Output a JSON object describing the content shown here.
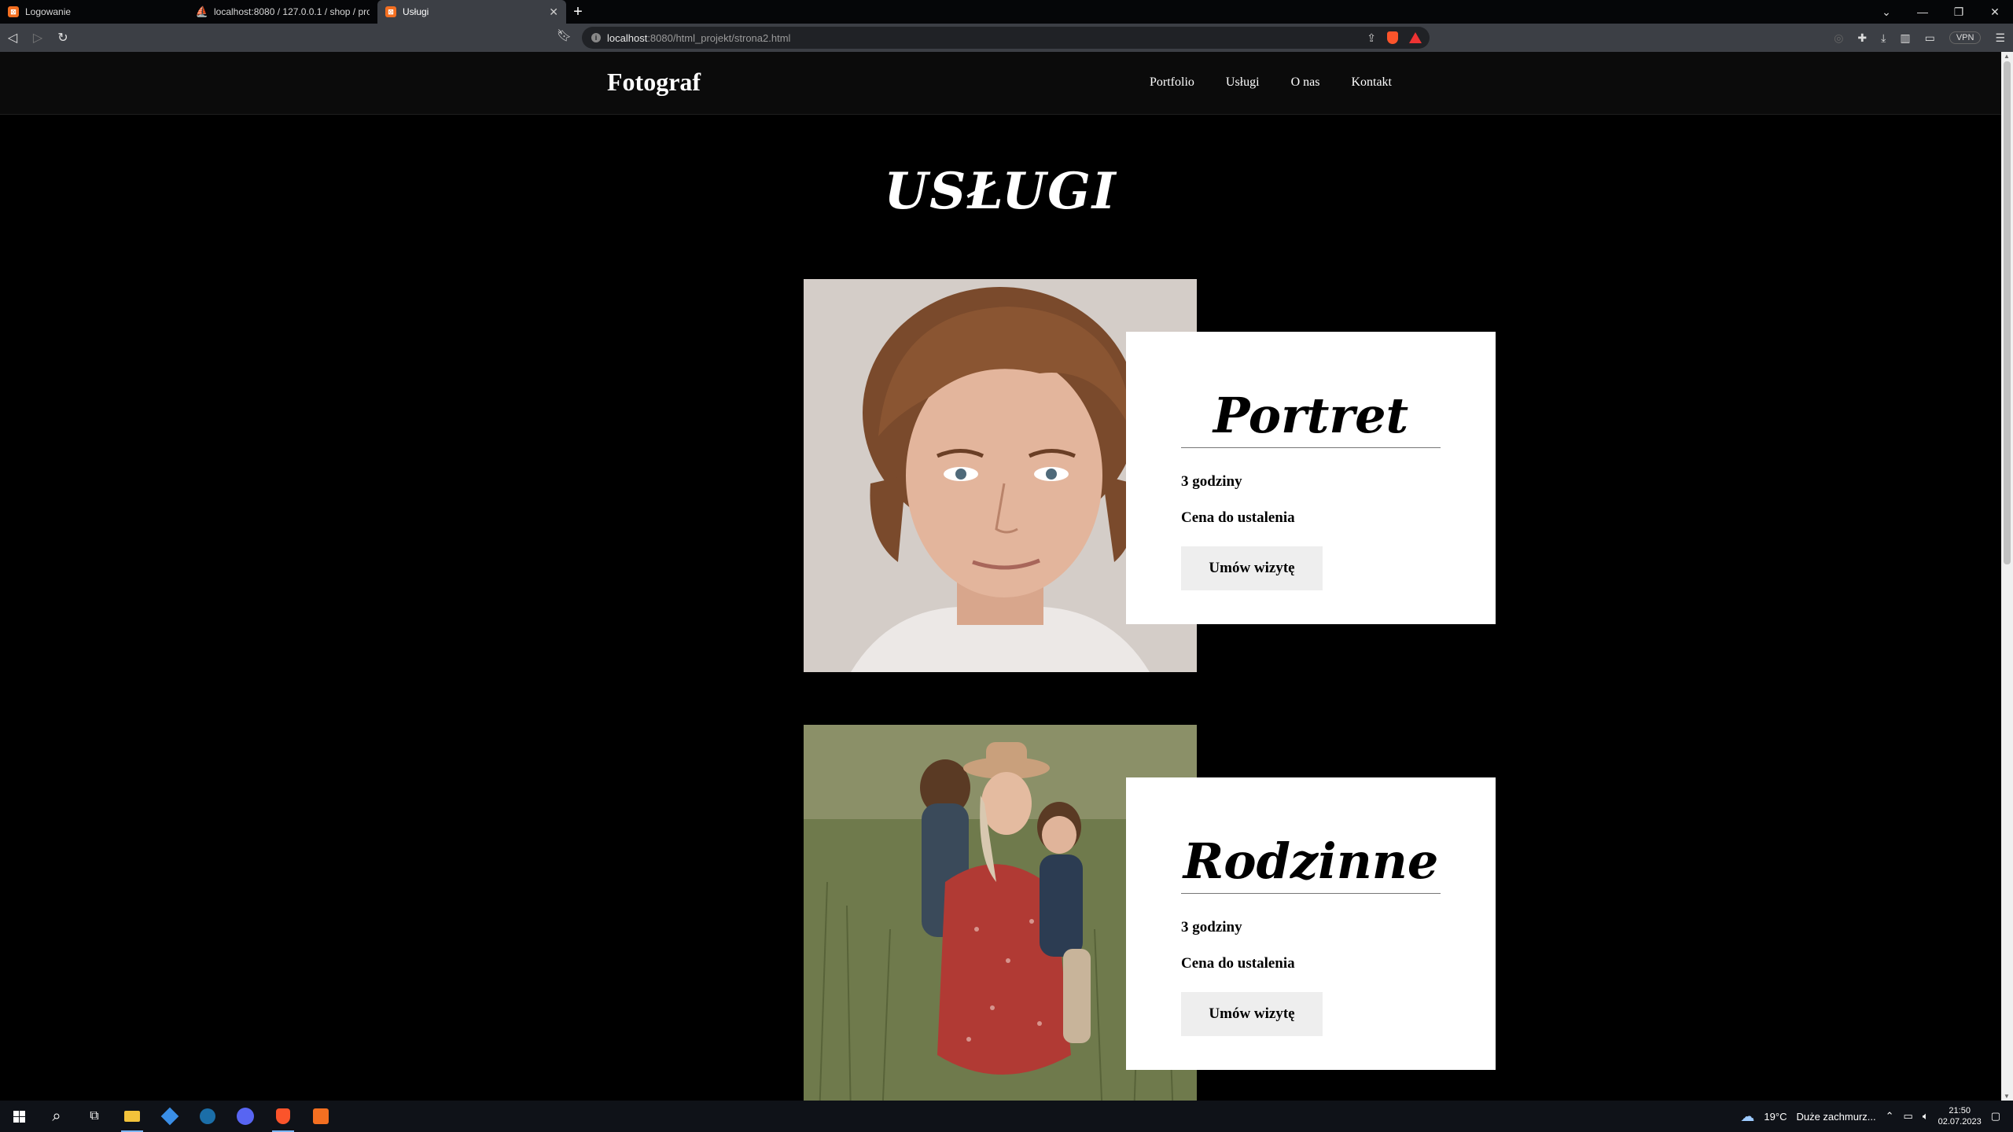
{
  "browser": {
    "tabs": [
      {
        "title": "Logowanie",
        "icon": "xampp-icon",
        "active": false
      },
      {
        "title": "localhost:8080 / 127.0.0.1 / shop / pro",
        "icon": "phpmyadmin-icon",
        "active": false
      },
      {
        "title": "Usługi",
        "icon": "xampp-icon",
        "active": true
      }
    ],
    "url_host": "localhost",
    "url_rest": ":8080/html_projekt/strona2.html",
    "vpn_label": "VPN"
  },
  "site": {
    "logo": "Fotograf",
    "nav": [
      "Portfolio",
      "Usługi",
      "O nas",
      "Kontakt"
    ],
    "heading": "USŁUGI",
    "services": [
      {
        "title": "Portret",
        "duration": "3 godziny",
        "price": "Cena do ustalenia",
        "button": "Umów wizytę"
      },
      {
        "title": "Rodzinne",
        "duration": "3 godziny",
        "price": "Cena do ustalenia",
        "button": "Umów wizytę"
      }
    ]
  },
  "taskbar": {
    "weather_temp": "19°C",
    "weather_text": "Duże zachmurz...",
    "time": "21:50",
    "date": "02.07.2023"
  }
}
